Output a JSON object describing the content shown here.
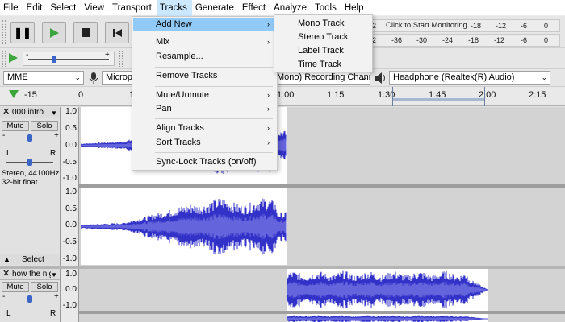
{
  "menubar": {
    "items": [
      "File",
      "Edit",
      "Select",
      "View",
      "Transport",
      "Tracks",
      "Generate",
      "Effect",
      "Analyze",
      "Tools",
      "Help"
    ]
  },
  "transport": {
    "pause": "pause-icon",
    "play": "play-icon",
    "stop": "stop-icon",
    "skip_start": "skip-start-icon"
  },
  "meters": {
    "record_hint": "Click to Start Monitoring",
    "record_scale": [
      "-18",
      "-12",
      "-6",
      "0"
    ],
    "playback_scale": [
      "-36",
      "-30",
      "-24",
      "-18",
      "-12",
      "-6",
      "0"
    ],
    "left_partial_top": "2",
    "left_partial_bottom": "2"
  },
  "device": {
    "host": "MME",
    "recording_device": "Microph",
    "recording_channels": "Mono) Recording Channe",
    "playback_device": "Headphone (Realtek(R) Audio)"
  },
  "ruler": {
    "ticks": [
      "-15",
      "0",
      "1",
      "1:00",
      "1:15",
      "1:30",
      "1:45",
      "2:00",
      "2:15"
    ]
  },
  "tracks": [
    {
      "name": "000 intro",
      "mute": "Mute",
      "solo": "Solo",
      "pan_left": "L",
      "pan_right": "R",
      "info1": "Stereo, 44100Hz",
      "info2": "32-bit float",
      "select": "Select",
      "scale": [
        "1.0",
        "0.5",
        "0.0",
        "-0.5",
        "-1.0",
        "1.0",
        "0.5",
        "0.0",
        "-0.5",
        "-1.0"
      ]
    },
    {
      "name": "how the nigh",
      "mute": "Mute",
      "solo": "Solo",
      "pan_left": "L",
      "pan_right": "R",
      "scale": [
        "1.0",
        "0.0",
        "-1.0"
      ]
    }
  ],
  "tracks_menu": {
    "items": [
      {
        "label": "Add New",
        "submenu": true,
        "highlighted": true
      },
      {
        "label": "Mix",
        "submenu": true
      },
      {
        "label": "Resample..."
      },
      {
        "label": "Remove Tracks"
      },
      {
        "label": "Mute/Unmute",
        "submenu": true
      },
      {
        "label": "Pan",
        "submenu": true
      },
      {
        "label": "Align Tracks",
        "submenu": true
      },
      {
        "label": "Sort Tracks",
        "submenu": true
      },
      {
        "label": "Sync-Lock Tracks (on/off)"
      }
    ]
  },
  "add_new_menu": {
    "items": [
      "Mono Track",
      "Stereo Track",
      "Label Track",
      "Time Track"
    ]
  },
  "colors": {
    "waveform": "#3232c8",
    "waveform_rms": "#6464dc",
    "menu_highlight": "#91c9f7",
    "menubar_open": "#cce8ff"
  }
}
